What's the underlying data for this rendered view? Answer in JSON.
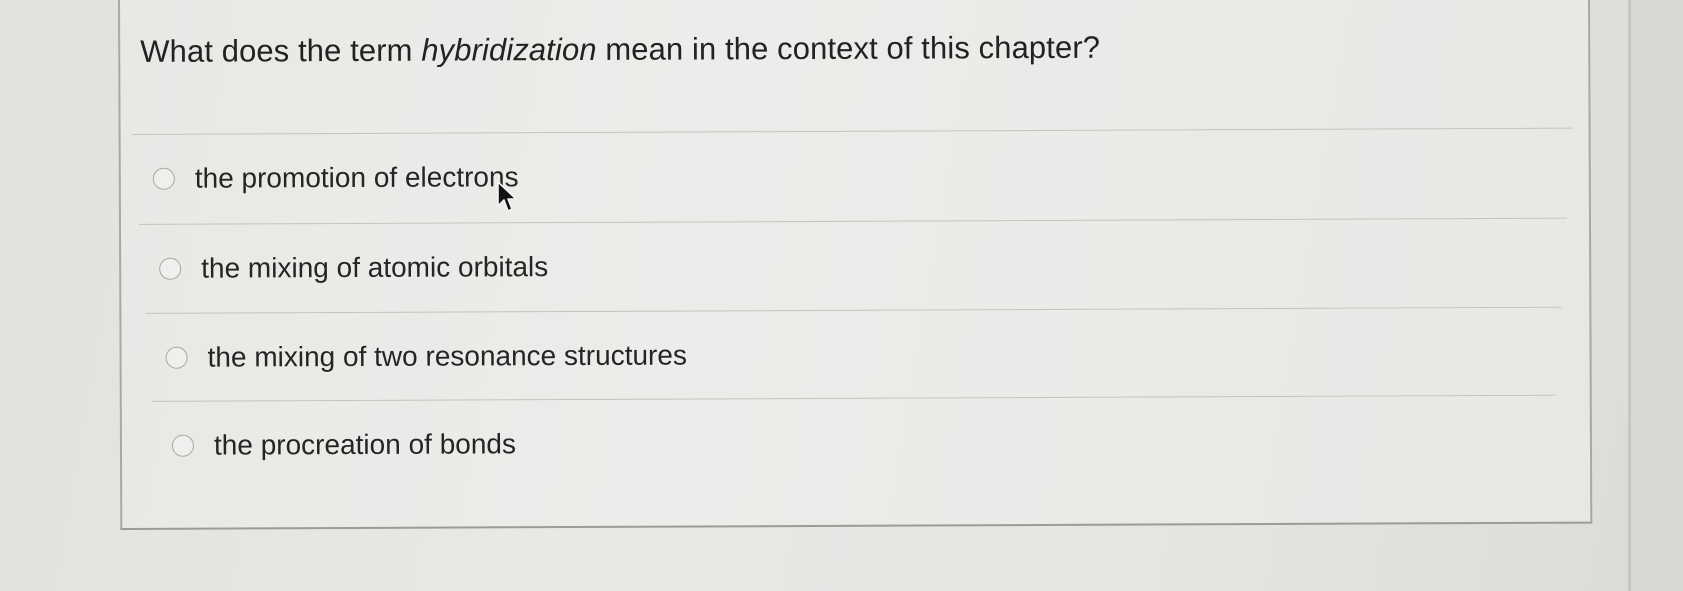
{
  "question": {
    "prefix": "What does the term ",
    "term": "hybridization",
    "suffix": " mean in the context of this chapter?"
  },
  "options": [
    {
      "label": "the promotion of electrons",
      "selected": false
    },
    {
      "label": "the mixing of atomic orbitals",
      "selected": false
    },
    {
      "label": "the mixing of two resonance structures",
      "selected": false
    },
    {
      "label": "the procreation of bonds",
      "selected": false
    }
  ],
  "icons": {
    "radio": "radio-button-icon",
    "cursor": "mouse-pointer-icon"
  }
}
